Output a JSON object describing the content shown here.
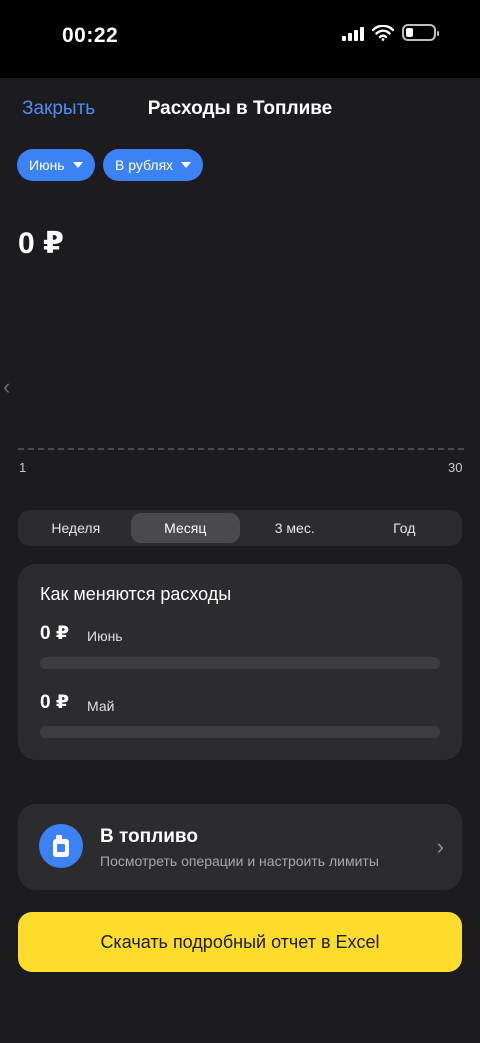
{
  "status_bar": {
    "time": "00:22"
  },
  "header": {
    "close_label": "Закрыть",
    "title": "Расходы в Топливе"
  },
  "filters": {
    "month": "Июнь",
    "currency": "В рублях"
  },
  "summary": {
    "total": "0 ₽"
  },
  "chart_axis": {
    "start": "1",
    "end": "30"
  },
  "periods": [
    "Неделя",
    "Месяц",
    "3 мес.",
    "Год"
  ],
  "active_period": "Месяц",
  "changes": {
    "title": "Как меняются расходы",
    "rows": [
      {
        "amount": "0 ₽",
        "label": "Июнь",
        "fill": 0
      },
      {
        "amount": "0 ₽",
        "label": "Май",
        "fill": 0
      }
    ]
  },
  "fuel_card": {
    "title": "В топливо",
    "subtitle": "Посмотреть операции и настроить лимиты",
    "icon": "fuel-icon"
  },
  "download_button": "Скачать подробный отчет в Excel",
  "colors": {
    "accent": "#3b82f6",
    "link": "#4c8ef7",
    "button": "#fddc2c",
    "background": "#1c1c1e",
    "card": "#2c2c2e"
  }
}
